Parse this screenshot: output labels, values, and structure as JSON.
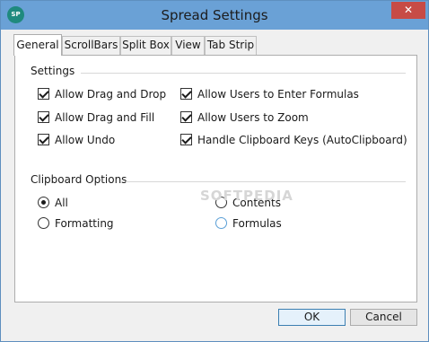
{
  "window": {
    "title": "Spread Settings",
    "app_icon_text": "SP",
    "close_glyph": "✕"
  },
  "tabs": [
    {
      "label": "General",
      "active": true
    },
    {
      "label": "ScrollBars",
      "active": false
    },
    {
      "label": "Split Box",
      "active": false
    },
    {
      "label": "View",
      "active": false
    },
    {
      "label": "Tab Strip",
      "active": false
    }
  ],
  "settings": {
    "group_label": "Settings",
    "options": [
      {
        "label": "Allow Drag and Drop",
        "checked": true
      },
      {
        "label": "Allow Drag and Fill",
        "checked": true
      },
      {
        "label": "Allow Undo",
        "checked": true
      },
      {
        "label": "Allow Users to Enter Formulas",
        "checked": true
      },
      {
        "label": "Allow Users to Zoom",
        "checked": true
      },
      {
        "label": "Handle Clipboard Keys (AutoClipboard)",
        "checked": true
      }
    ]
  },
  "clipboard": {
    "group_label": "Clipboard Options",
    "selected": "All",
    "options": [
      {
        "label": "All"
      },
      {
        "label": "Formatting"
      },
      {
        "label": "Contents"
      },
      {
        "label": "Formulas"
      }
    ]
  },
  "watermark": "SOFTPEDIA",
  "buttons": {
    "ok": "OK",
    "cancel": "Cancel"
  },
  "colors": {
    "titlebar": "#6aa1d6",
    "close": "#c74b46",
    "app_icon": "#1f8a7e"
  }
}
